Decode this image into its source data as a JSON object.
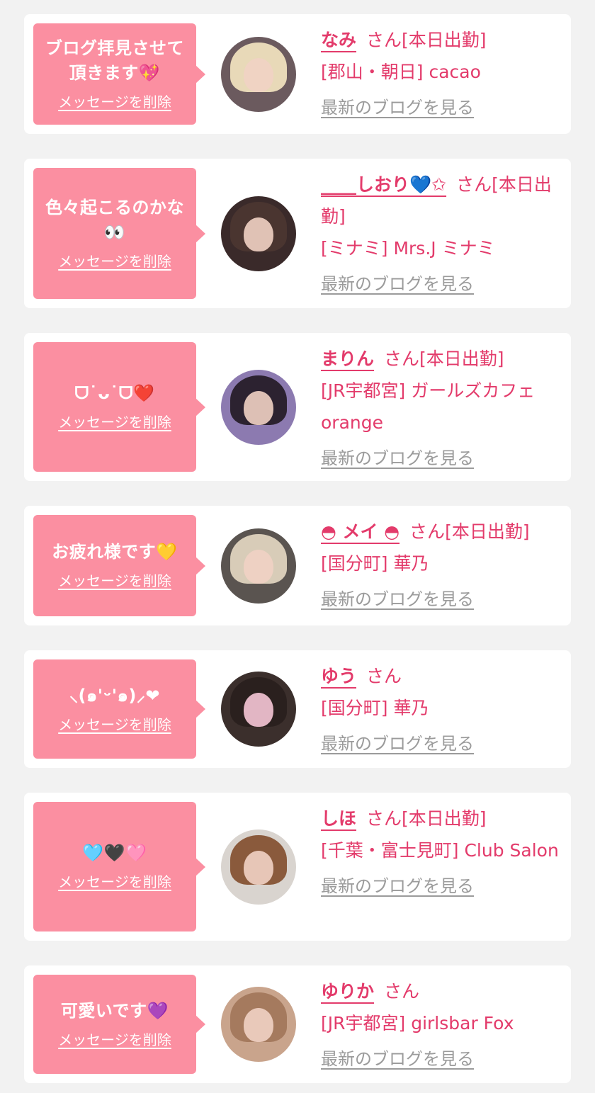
{
  "messages": [
    {
      "bubble_text": "ブログ拝見させて頂きます💖",
      "delete_label": "メッセージを削除",
      "name": "なみ",
      "honorific": "さん",
      "status": "[本日出勤]",
      "shop": "[郡山・朝日] cacao",
      "blog_link": "最新のブログを見る"
    },
    {
      "bubble_text": "色々起こるのかな👀",
      "delete_label": "メッセージを削除",
      "name": "____しおり💙✩",
      "honorific": "さん",
      "status": "[本日出勤]",
      "shop": "[ミナミ] Mrs.J ミナミ",
      "blog_link": "最新のブログを見る"
    },
    {
      "bubble_text": "ᗜ˙ᴗ˙ᗜ❤️",
      "delete_label": "メッセージを削除",
      "name": "まりん",
      "honorific": "さん",
      "status": "[本日出勤]",
      "shop": "[JR宇都宮] ガールズカフェorange",
      "blog_link": "最新のブログを見る"
    },
    {
      "bubble_text": "お疲れ様です💛",
      "delete_label": "メッセージを削除",
      "name": "◓ メイ ◓",
      "honorific": "さん",
      "status": "[本日出勤]",
      "shop": "[国分町] 華乃",
      "blog_link": "最新のブログを見る"
    },
    {
      "bubble_text": "‎⸜(๑'ᵕ'๑)⸝❤︎",
      "delete_label": "メッセージを削除",
      "name": "ゆう",
      "honorific": "さん",
      "status": "",
      "shop": "[国分町] 華乃",
      "blog_link": "最新のブログを見る"
    },
    {
      "bubble_text": "🩵🖤🩷",
      "delete_label": "メッセージを削除",
      "name": "しほ",
      "honorific": "さん",
      "status": "[本日出勤]",
      "shop": "[千葉・富士見町] Club Salon",
      "blog_link": "最新のブログを見る"
    },
    {
      "bubble_text": "可愛いです💜",
      "delete_label": "メッセージを削除",
      "name": "ゆりか",
      "honorific": "さん",
      "status": "",
      "shop": "[JR宇都宮] girlsbar Fox",
      "blog_link": "最新のブログを見る"
    }
  ]
}
